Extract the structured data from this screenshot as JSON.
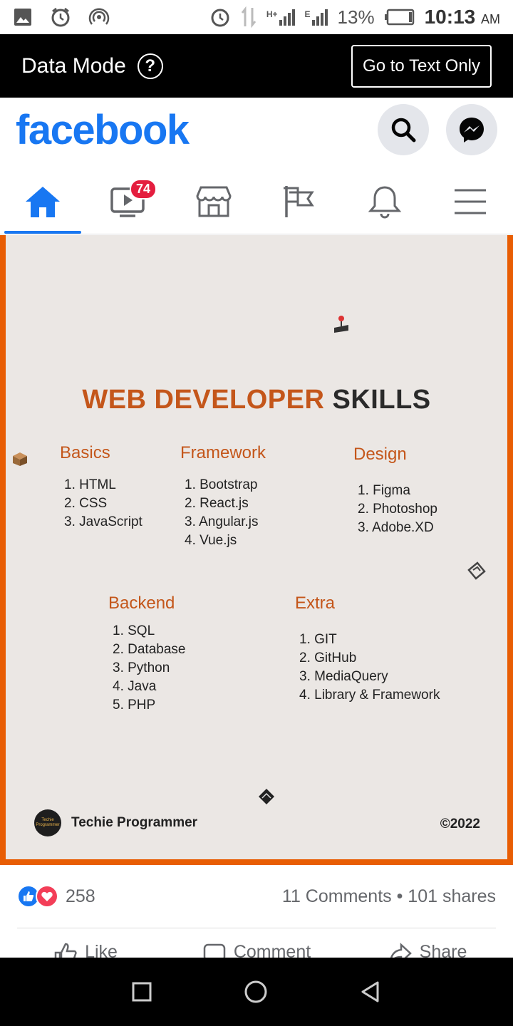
{
  "status_bar": {
    "battery": "13%",
    "time": "10:13",
    "ampm": "AM",
    "network_h": "H+",
    "network_e": "E"
  },
  "data_mode": {
    "label": "Data Mode",
    "help": "?",
    "button": "Go to Text Only"
  },
  "header": {
    "logo": "facebook"
  },
  "tabs": [
    {
      "name": "home",
      "active": true
    },
    {
      "name": "watch",
      "badge": "74"
    },
    {
      "name": "marketplace"
    },
    {
      "name": "pages"
    },
    {
      "name": "notifications"
    },
    {
      "name": "menu"
    }
  ],
  "post_image": {
    "title_part1": "WEB DEVELOPER",
    "title_part2": " SKILLS",
    "columns": [
      {
        "heading": "Basics",
        "items": [
          "1. HTML",
          "2. CSS",
          "3. JavaScript"
        ]
      },
      {
        "heading": "Framework",
        "items": [
          "1. Bootstrap",
          "2. React.js",
          "3. Angular.js",
          "4. Vue.js"
        ]
      },
      {
        "heading": "Design",
        "items": [
          "1. Figma",
          "2. Photoshop",
          "3. Adobe.XD"
        ]
      },
      {
        "heading": "Backend",
        "items": [
          "1. SQL",
          "2. Database",
          "3. Python",
          "4. Java",
          "5. PHP"
        ]
      },
      {
        "heading": "Extra",
        "items": [
          "1. GIT",
          "2. GitHub",
          "3. MediaQuery",
          "4. Library & Framework"
        ]
      }
    ],
    "brand": "Techie Programmer",
    "brand_logo_text": "Techie Programmer",
    "copyright": "©2022",
    "colors": {
      "accent": "#c4561a",
      "frame": "#e85d04",
      "background": "#ebe7e4"
    }
  },
  "reactions": {
    "count": "258",
    "stats": "11 Comments • 101 shares"
  },
  "actions": {
    "like": "Like",
    "comment": "Comment",
    "share": "Share"
  }
}
